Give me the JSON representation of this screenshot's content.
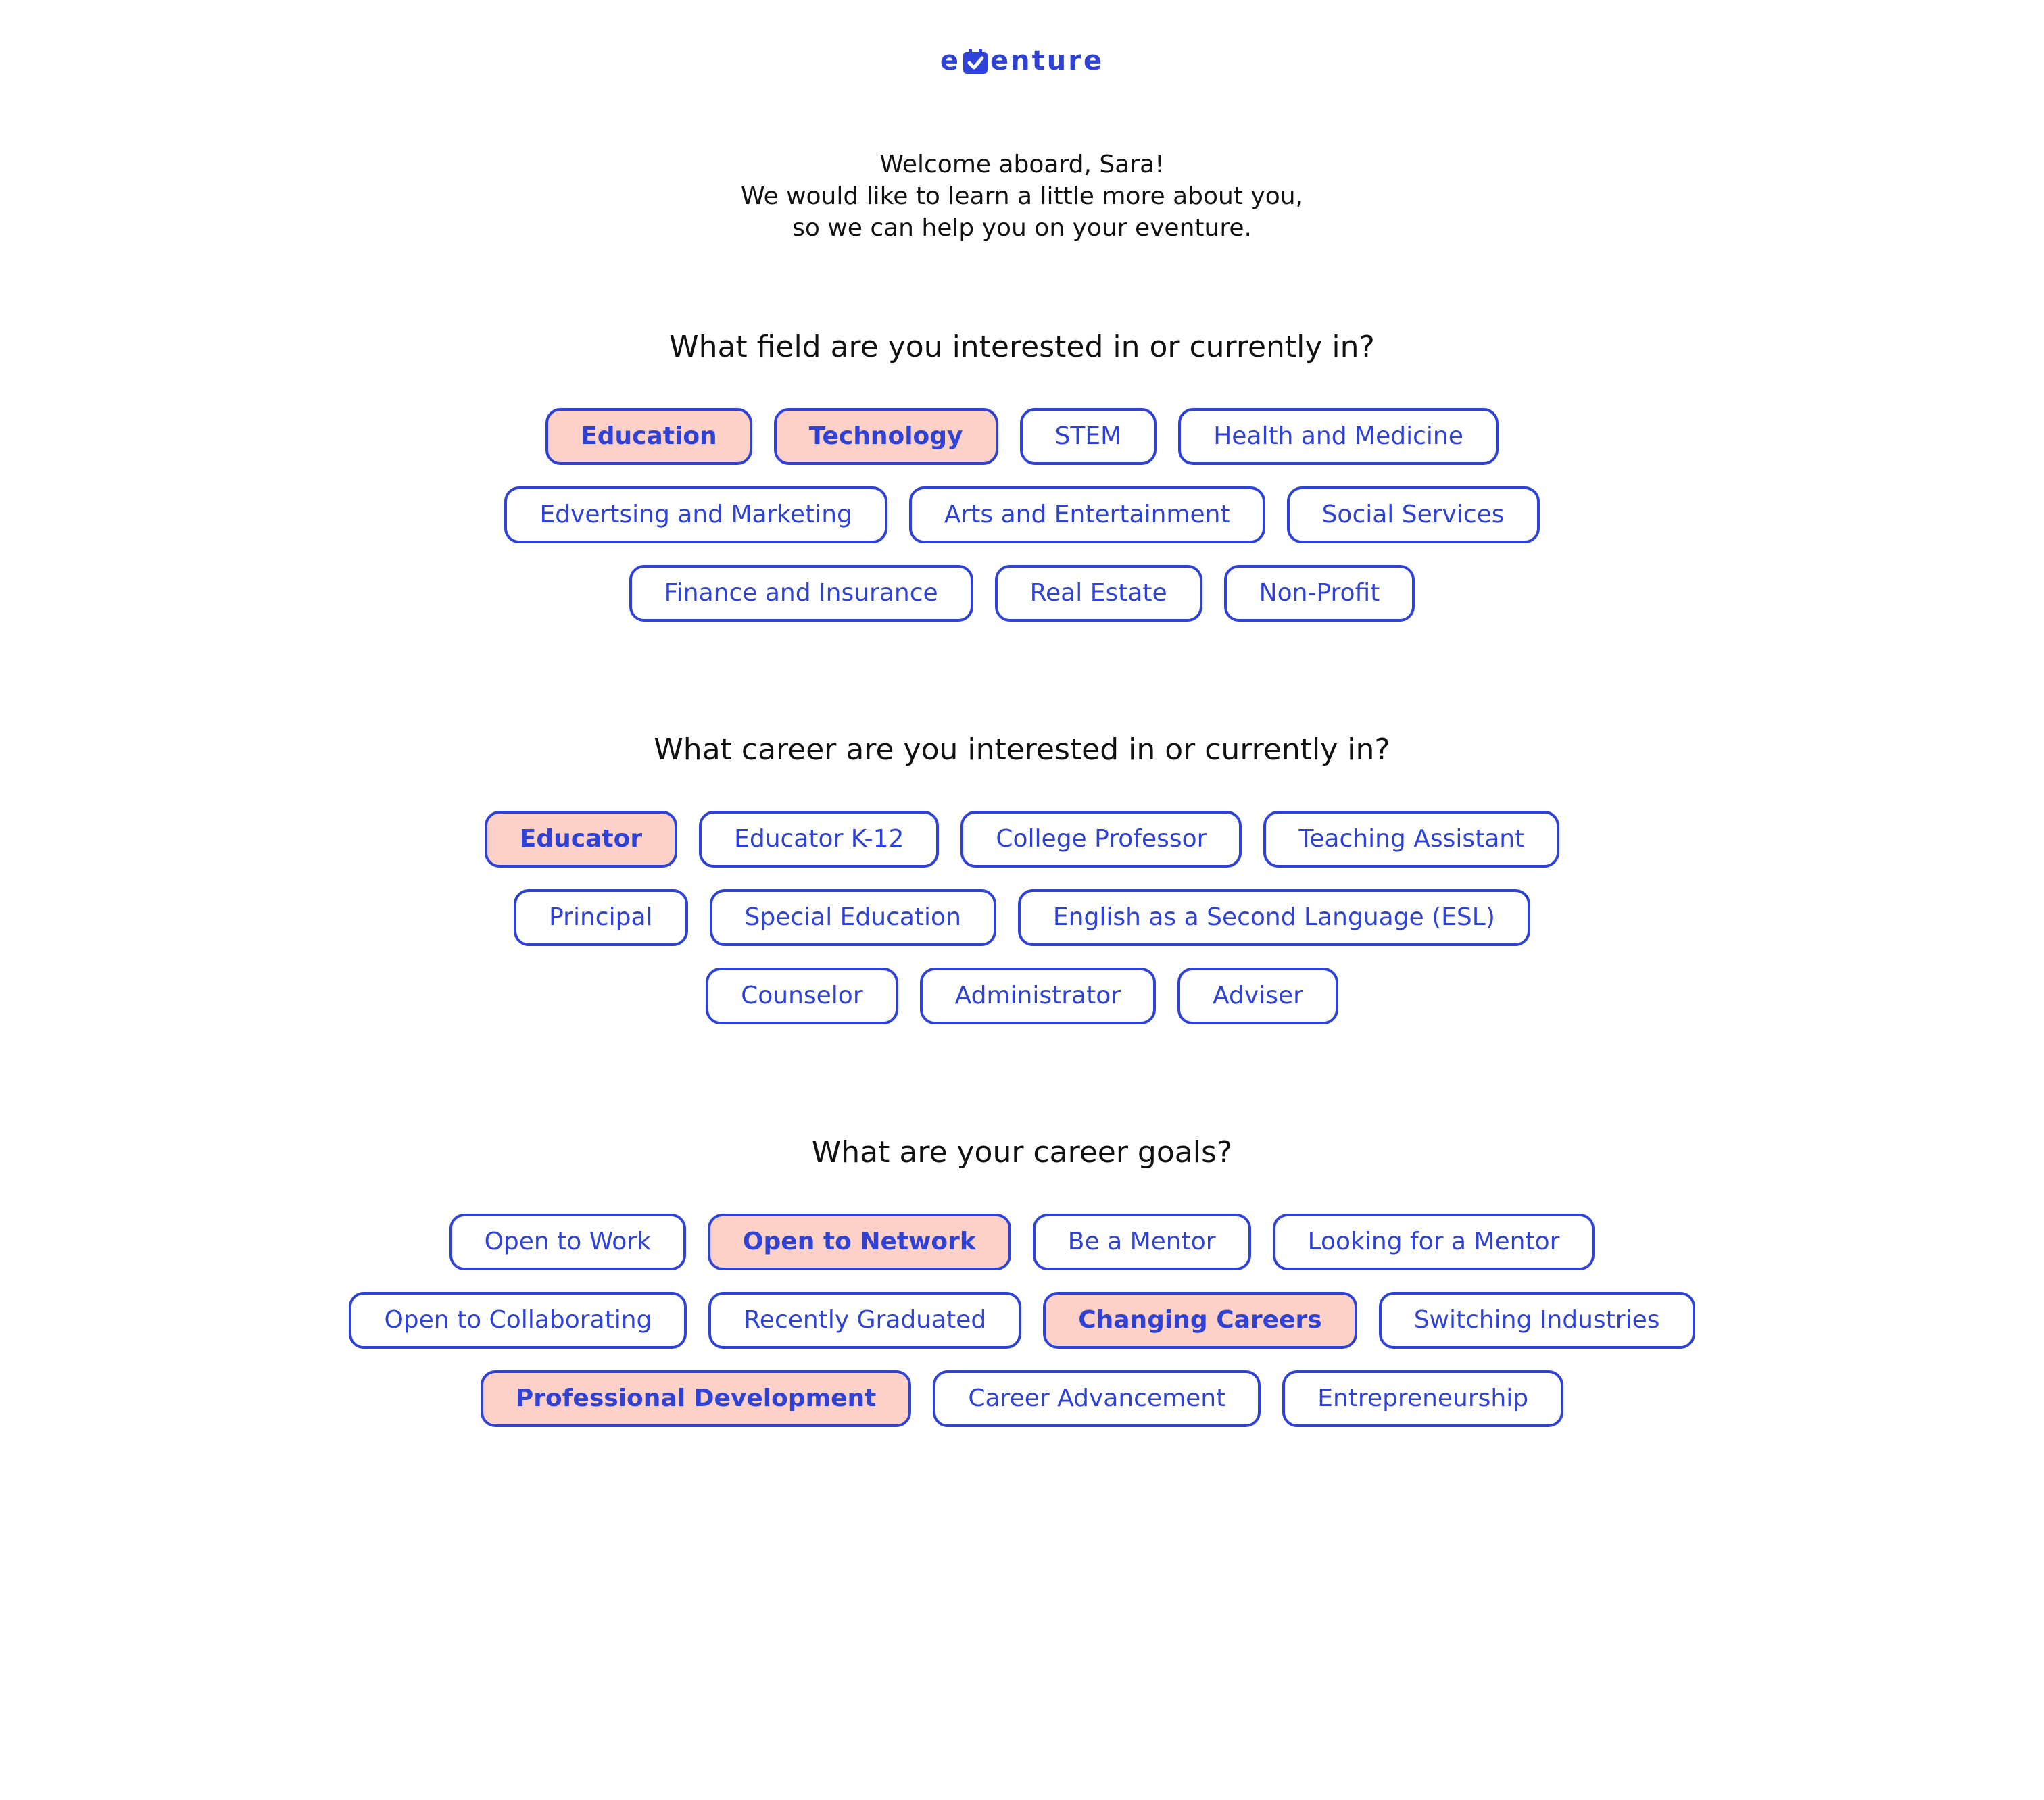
{
  "logo": {
    "prefix": "e",
    "suffix": "enture",
    "icon": "calendar-check-icon",
    "brand_color": "#2f42d8"
  },
  "intro": {
    "line1": "Welcome aboard, Sara!",
    "line2": "We would like to learn a little more about you,",
    "line3": "so we can help you on your eventure."
  },
  "colors": {
    "accent": "#2f42d8",
    "selected_bg": "#fdd0c8"
  },
  "sections": [
    {
      "question": "What field are you interested in or currently in?",
      "rows": [
        [
          {
            "label": "Education",
            "selected": true
          },
          {
            "label": "Technology",
            "selected": true
          },
          {
            "label": "STEM",
            "selected": false
          },
          {
            "label": "Health and Medicine",
            "selected": false
          }
        ],
        [
          {
            "label": "Edvertsing and Marketing",
            "selected": false
          },
          {
            "label": "Arts and Entertainment",
            "selected": false
          },
          {
            "label": "Social Services",
            "selected": false
          }
        ],
        [
          {
            "label": "Finance and Insurance",
            "selected": false
          },
          {
            "label": "Real Estate",
            "selected": false
          },
          {
            "label": "Non-Profit",
            "selected": false
          }
        ]
      ]
    },
    {
      "question": "What career are you interested in or currently in?",
      "rows": [
        [
          {
            "label": "Educator",
            "selected": true
          },
          {
            "label": "Educator K-12",
            "selected": false
          },
          {
            "label": "College Professor",
            "selected": false
          },
          {
            "label": "Teaching Assistant",
            "selected": false
          }
        ],
        [
          {
            "label": "Principal",
            "selected": false
          },
          {
            "label": "Special Education",
            "selected": false
          },
          {
            "label": "English as a Second Language (ESL)",
            "selected": false
          }
        ],
        [
          {
            "label": "Counselor",
            "selected": false
          },
          {
            "label": "Administrator",
            "selected": false
          },
          {
            "label": "Adviser",
            "selected": false
          }
        ]
      ]
    },
    {
      "question": "What are your career goals?",
      "rows": [
        [
          {
            "label": "Open to Work",
            "selected": false
          },
          {
            "label": "Open to Network",
            "selected": true
          },
          {
            "label": "Be a Mentor",
            "selected": false
          },
          {
            "label": "Looking for a Mentor",
            "selected": false
          }
        ],
        [
          {
            "label": "Open to Collaborating",
            "selected": false
          },
          {
            "label": "Recently Graduated",
            "selected": false
          },
          {
            "label": "Changing Careers",
            "selected": true
          },
          {
            "label": "Switching Industries",
            "selected": false
          }
        ],
        [
          {
            "label": "Professional Development",
            "selected": true
          },
          {
            "label": "Career Advancement",
            "selected": false
          },
          {
            "label": "Entrepreneurship",
            "selected": false
          }
        ]
      ]
    }
  ]
}
